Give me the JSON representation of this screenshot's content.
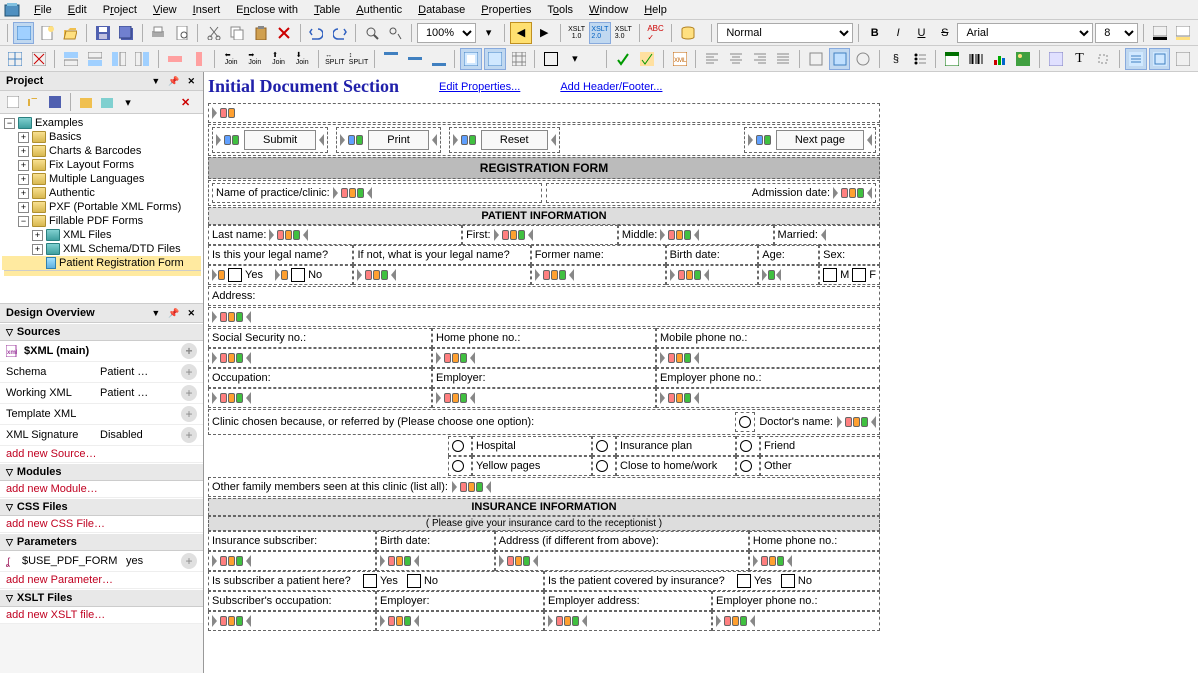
{
  "menu": {
    "items": [
      "File",
      "Edit",
      "Project",
      "View",
      "Insert",
      "Enclose with",
      "Table",
      "Authentic",
      "Database",
      "Properties",
      "Tools",
      "Window",
      "Help"
    ]
  },
  "toolbar1": {
    "zoom": "100%",
    "xslt_btns": [
      "XSLT 1.0",
      "XSLT 2.0",
      "XSLT 3.0"
    ]
  },
  "toolbar_font": {
    "style": "Normal",
    "face": "Arial",
    "size": "8"
  },
  "project": {
    "title": "Project",
    "root": "Examples",
    "items": [
      "Basics",
      "Charts & Barcodes",
      "Fix Layout Forms",
      "Multiple Languages",
      "Authentic",
      "PXF (Portable XML Forms)",
      "Fillable PDF Forms"
    ],
    "sub_items": [
      "XML Files",
      "XML Schema/DTD Files",
      "Patient Registration Form"
    ]
  },
  "overview": {
    "title": "Design Overview",
    "sources_hdr": "Sources",
    "main_xml": "$XML (main)",
    "rows": [
      {
        "k": "Schema",
        "v": "Patient …"
      },
      {
        "k": "Working XML",
        "v": "Patient …"
      },
      {
        "k": "Template XML",
        "v": ""
      },
      {
        "k": "XML Signature",
        "v": "Disabled"
      }
    ],
    "add_source": "add new Source…",
    "modules_hdr": "Modules",
    "add_module": "add new Module…",
    "css_hdr": "CSS Files",
    "add_css": "add new CSS File…",
    "params_hdr": "Parameters",
    "param_row": {
      "k": "$USE_PDF_FORM",
      "v": "yes"
    },
    "add_param": "add new Parameter…",
    "xslt_hdr": "XSLT Files",
    "add_xslt": "add new XSLT file…"
  },
  "doc": {
    "title": "Initial Document Section",
    "link1": "Edit Properties...",
    "link2": "Add Header/Footer...",
    "btn_submit": "Submit",
    "btn_print": "Print",
    "btn_reset": "Reset",
    "btn_next": "Next page",
    "reg_form": "REGISTRATION FORM",
    "practice": "Name of practice/clinic:",
    "admission": "Admission date:",
    "patient_info": "PATIENT INFORMATION",
    "lastname": "Last name:",
    "first": "First:",
    "middle": "Middle:",
    "married": "Married:",
    "legal_q": "Is this your legal name?",
    "legal_ifnot": "If not, what is your legal name?",
    "former": "Former name:",
    "birth": "Birth date:",
    "age": "Age:",
    "sex": "Sex:",
    "yes": "Yes",
    "no": "No",
    "m": "M",
    "f": "F",
    "address": "Address:",
    "ssn": "Social Security no.:",
    "home_ph": "Home phone no.:",
    "mobile_ph": "Mobile phone no.:",
    "occupation": "Occupation:",
    "employer": "Employer:",
    "employer_ph": "Employer phone no.:",
    "clinic_chosen": "Clinic chosen because, or referred by (Please choose one option):",
    "doctor_name": "Doctor's name:",
    "hospital": "Hospital",
    "insplan": "Insurance plan",
    "friend": "Friend",
    "yellow": "Yellow pages",
    "close": "Close to home/work",
    "other": "Other",
    "family": "Other family members seen at this clinic (list all):",
    "ins_info": "INSURANCE INFORMATION",
    "ins_note": "( Please give your insurance card to the receptionist )",
    "ins_sub": "Insurance subscriber:",
    "ins_birth": "Birth date:",
    "ins_addr": "Address (if different from above):",
    "ins_home": "Home phone no.:",
    "sub_patient": "Is subscriber a patient here?",
    "covered": "Is the patient covered by insurance?",
    "sub_occ": "Subscriber's occupation:",
    "sub_emp": "Employer:",
    "sub_emp_addr": "Employer address:",
    "sub_emp_ph": "Employer phone no.:"
  }
}
